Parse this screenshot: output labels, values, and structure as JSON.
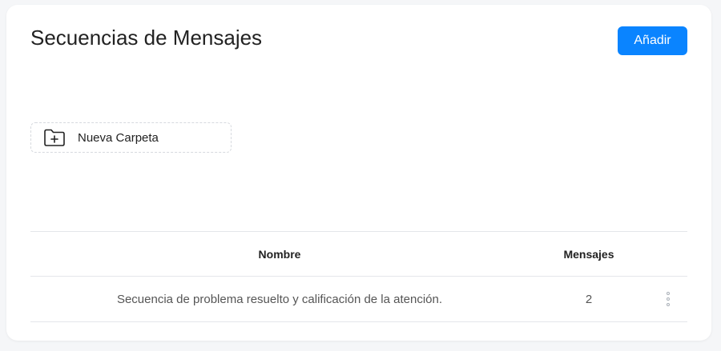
{
  "header": {
    "title": "Secuencias de Mensajes",
    "add_label": "Añadir"
  },
  "folder": {
    "new_label": "Nueva Carpeta",
    "icon": "folder-plus-icon"
  },
  "table": {
    "columns": [
      "Nombre",
      "Mensajes"
    ],
    "rows": [
      {
        "name": "Secuencia de problema resuelto y calificación de la atención.",
        "messages": "2",
        "actions_icon": "more-vertical-icon"
      }
    ]
  },
  "colors": {
    "accent": "#0a84ff",
    "background": "#f5f6f8",
    "card": "#ffffff"
  }
}
